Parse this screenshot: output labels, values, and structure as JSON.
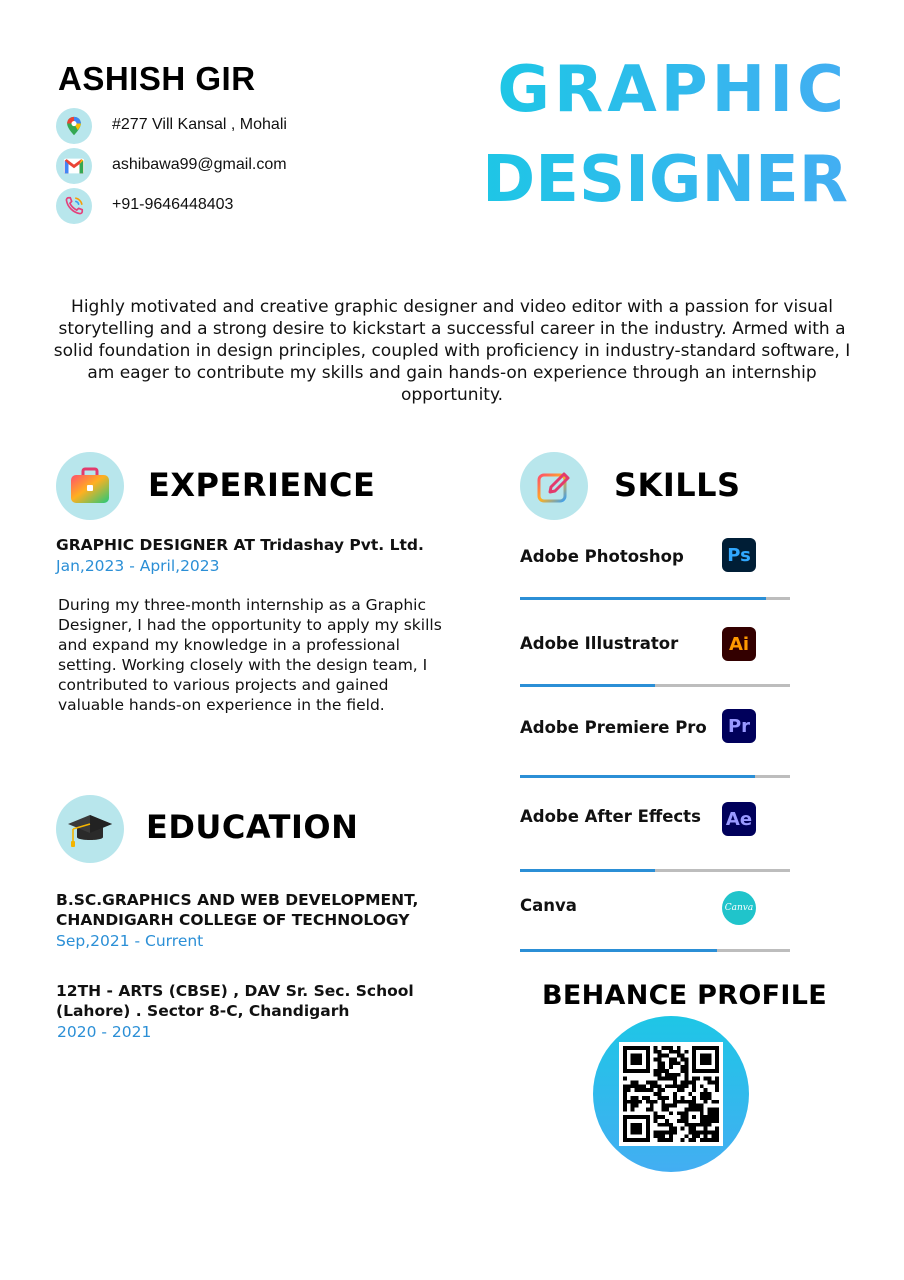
{
  "header": {
    "name": "ASHISH GIR",
    "role_line1": "GRAPHIC",
    "role_line2": "DESIGNER"
  },
  "contact": [
    {
      "icon": "map-pin-icon",
      "text": "#277 Vill Kansal , Mohali"
    },
    {
      "icon": "gmail-icon",
      "text": "ashibawa99@gmail.com"
    },
    {
      "icon": "phone-icon",
      "text": "+91-9646448403"
    }
  ],
  "summary": "Highly motivated and creative graphic designer and video editor with a passion for visual storytelling and a strong desire to kickstart a successful career in the industry. Armed with a solid foundation in design principles, coupled with proficiency in industry-standard software, I am eager to contribute my skills and gain hands-on experience through an internship opportunity.",
  "experience": {
    "heading": "EXPERIENCE",
    "icon": "briefcase-icon",
    "job_title": "GRAPHIC DESIGNER AT Tridashay Pvt. Ltd.",
    "dates": "Jan,2023 - April,2023",
    "description": "During my three-month internship as a Graphic Designer, I had the opportunity to apply my skills and expand my knowledge in a professional setting. Working closely with the design team, I contributed to various projects and gained valuable hands-on experience in the field."
  },
  "education": {
    "heading": "EDUCATION",
    "icon": "graduation-cap-icon",
    "items": [
      {
        "line1": "B.SC.GRAPHICS AND WEB DEVELOPMENT,",
        "line2": "CHANDIGARH COLLEGE OF TECHNOLOGY",
        "dates": "Sep,2021 - Current"
      },
      {
        "line1": "12TH - ARTS (CBSE) , DAV Sr. Sec. School",
        "line2": "(Lahore) . Sector 8-C, Chandigarh",
        "dates": "2020 - 2021"
      }
    ]
  },
  "skills": {
    "heading": "SKILLS",
    "icon": "pencil-edit-icon",
    "items": [
      {
        "name": "Adobe Photoshop",
        "logo": "Ps",
        "level": 0.91,
        "logo_bg": "#001e36",
        "logo_fg": "#31a8ff"
      },
      {
        "name": "Adobe Illustrator",
        "logo": "Ai",
        "level": 0.5,
        "logo_bg": "#330000",
        "logo_fg": "#ff9a00"
      },
      {
        "name": "Adobe Premiere Pro",
        "logo": "Pr",
        "level": 0.87,
        "logo_bg": "#00005b",
        "logo_fg": "#9999ff"
      },
      {
        "name": "Adobe After Effects",
        "logo": "Ae",
        "level": 0.5,
        "logo_bg": "#00005b",
        "logo_fg": "#9999ff"
      },
      {
        "name": "Canva",
        "logo": "Canva",
        "level": 0.73,
        "logo_bg": "#20c4cb",
        "logo_fg": "#ffffff"
      }
    ]
  },
  "behance": {
    "heading": "BEHANCE PROFILE"
  },
  "colors": {
    "accent": "#2b8fd6",
    "icon_circle": "#b8e6ec",
    "gradient_start": "#1ec6e6",
    "gradient_end": "#43aef2"
  }
}
